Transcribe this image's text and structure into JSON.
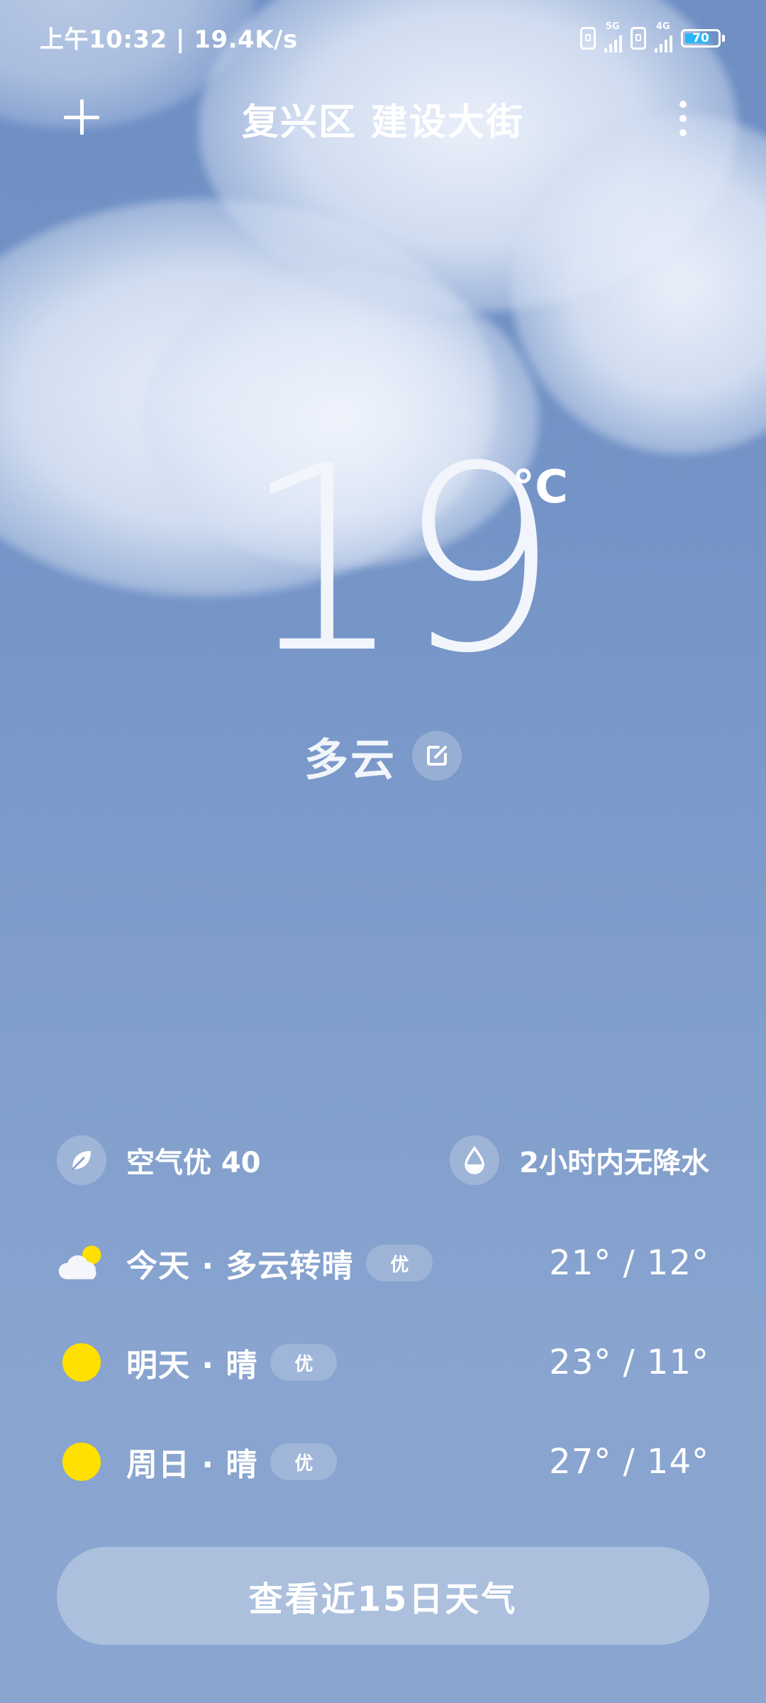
{
  "status_bar": {
    "time_speed": "上午10:32 | 19.4K/s",
    "sim1_network": "5G",
    "sim2_network": "4G",
    "battery": "70"
  },
  "header": {
    "location": "复兴区 建设大街"
  },
  "current": {
    "temperature": "19",
    "unit": "°C",
    "condition": "多云"
  },
  "info": {
    "air_quality": "空气优 40",
    "precipitation": "2小时内无降水"
  },
  "forecast": [
    {
      "label": "今天 · 多云转晴",
      "aqi": "优",
      "temps": "21° / 12°",
      "icon": "partly-cloudy-icon"
    },
    {
      "label": "明天 · 晴",
      "aqi": "优",
      "temps": "23° / 11°",
      "icon": "sun-icon"
    },
    {
      "label": "周日 · 晴",
      "aqi": "优",
      "temps": "27° / 14°",
      "icon": "sun-icon"
    }
  ],
  "cta": {
    "label": "查看近15日天气"
  },
  "colors": {
    "sun": "#ffe000",
    "battery_fill": "#29b6f6",
    "sky_top": "#6f8fc4",
    "sky_bottom": "#8aa6d0"
  }
}
